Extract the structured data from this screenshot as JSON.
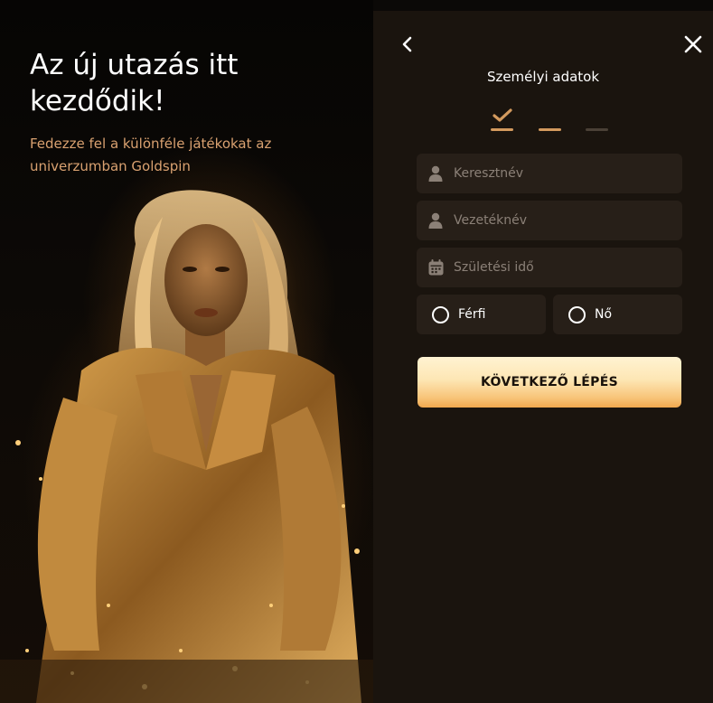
{
  "promo": {
    "headline": "Az új utazás itt kezdődik!",
    "subtitle": "Fedezze fel a különféle játékokat az univerzumban Goldspin"
  },
  "form": {
    "title": "Személyi adatok",
    "steps": {
      "total": 3,
      "current": 2,
      "completed": 1
    },
    "fields": {
      "first_name": {
        "placeholder": "Keresztnév",
        "value": ""
      },
      "last_name": {
        "placeholder": "Vezetéknév",
        "value": ""
      },
      "birth_date": {
        "placeholder": "Születési idő",
        "value": ""
      }
    },
    "gender": {
      "male_label": "Férfi",
      "female_label": "Nő",
      "selected": ""
    },
    "next_button_label": "KÖVETKEZŐ LÉPÉS"
  },
  "icons": {
    "back": "chevron-left-icon",
    "close": "close-icon",
    "step_done": "check-icon",
    "first_name": "user-icon",
    "last_name": "user-icon",
    "birth_date": "calendar-icon"
  },
  "colors": {
    "accent": "#d39a5e",
    "panel_bg": "#1a140e",
    "field_bg": "#271f18",
    "subtitle": "#d9a170",
    "button_gradient_top": "#fff3d2",
    "button_gradient_bottom": "#f0a84f"
  }
}
